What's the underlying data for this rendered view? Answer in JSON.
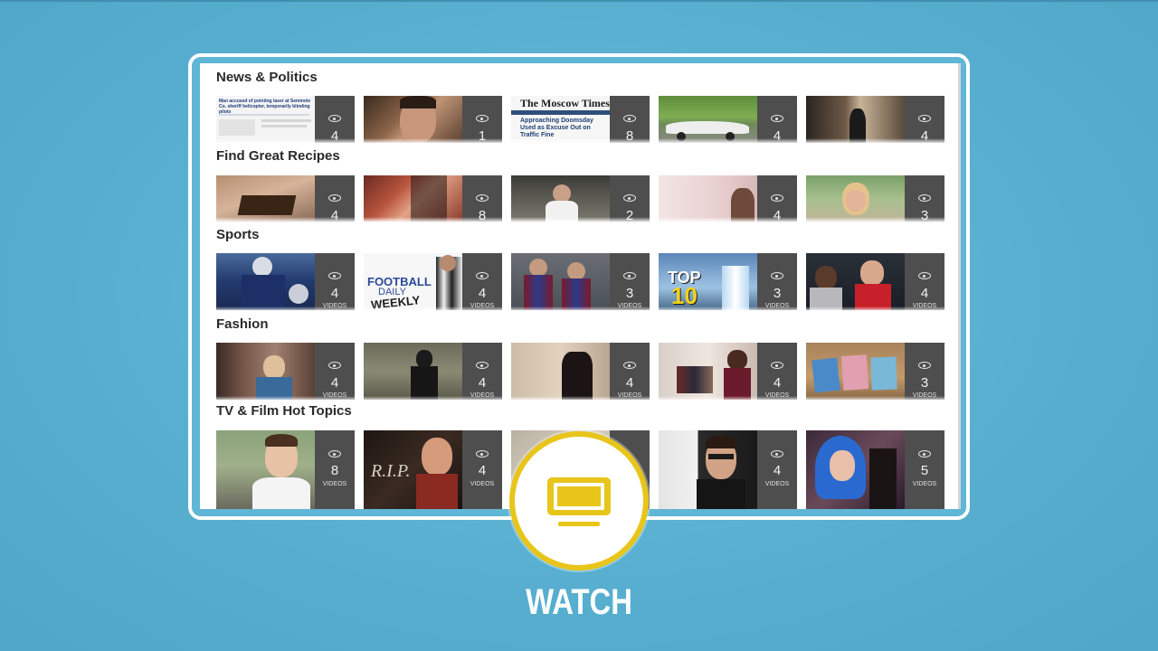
{
  "categories": [
    {
      "title": "News & Politics",
      "tiles": [
        {
          "count": "4",
          "label": ""
        },
        {
          "count": "1",
          "label": ""
        },
        {
          "count": "8",
          "label": ""
        },
        {
          "count": "4",
          "label": ""
        },
        {
          "count": "4",
          "label": ""
        }
      ]
    },
    {
      "title": "Find Great Recipes",
      "tiles": [
        {
          "count": "4",
          "label": ""
        },
        {
          "count": "8",
          "label": ""
        },
        {
          "count": "2",
          "label": ""
        },
        {
          "count": "4",
          "label": ""
        },
        {
          "count": "3",
          "label": ""
        }
      ]
    },
    {
      "title": "Sports",
      "tiles": [
        {
          "count": "4",
          "label": "VIDEOS"
        },
        {
          "count": "4",
          "label": "VIDEOS"
        },
        {
          "count": "3",
          "label": "VIDEOS"
        },
        {
          "count": "3",
          "label": "VIDEOS"
        },
        {
          "count": "4",
          "label": "VIDEOS"
        }
      ]
    },
    {
      "title": "Fashion",
      "tiles": [
        {
          "count": "4",
          "label": "VIDEOS"
        },
        {
          "count": "4",
          "label": "VIDEOS"
        },
        {
          "count": "4",
          "label": "VIDEOS"
        },
        {
          "count": "4",
          "label": "VIDEOS"
        },
        {
          "count": "3",
          "label": "VIDEOS"
        }
      ]
    },
    {
      "title": "TV & Film Hot Topics",
      "tiles": [
        {
          "count": "8",
          "label": "VIDEOS"
        },
        {
          "count": "4",
          "label": "VIDEOS"
        },
        {
          "count": "",
          "label": ""
        },
        {
          "count": "4",
          "label": "VIDEOS"
        },
        {
          "count": "5",
          "label": "VIDEOS"
        }
      ]
    }
  ],
  "thumb_text": {
    "moscow_times": "The Moscow Times",
    "moscow_headline": "Approaching Doomsday Used as Excuse Out on Traffic Fine",
    "news_headline": "Man accused of pointing laser at Seminole Co. sheriff helicopter, temporarily blinding pilots",
    "football_line1": "FOOTBALL",
    "football_line2": "DAILY",
    "football_line3": "WEEKLY",
    "top10_line1": "TOP",
    "top10_line2": "10",
    "rip": "R.I.P."
  },
  "watch": {
    "label": "WATCH",
    "icon": "tv-icon",
    "accent": "#e8c51a"
  }
}
